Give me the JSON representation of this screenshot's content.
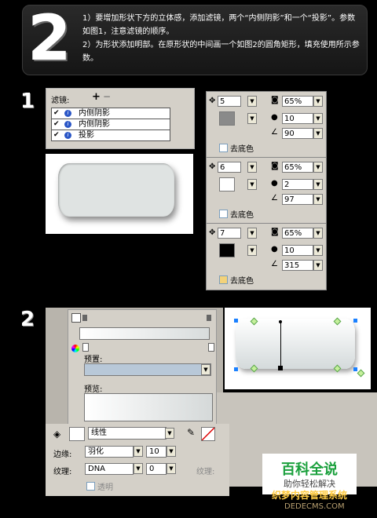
{
  "header": {
    "big_number": "2",
    "line1": "1）要增加形状下方的立体感，添加滤镜，两个“内侧阴影”和一个“投影”。参数如图1，注意滤镜的顺序。",
    "line2": "2）为形状添加明部。在原形状的中间画一个如图2的圆角矩形，填充使用所示参数。"
  },
  "steps": {
    "one": "1",
    "two": "2"
  },
  "filters": {
    "title": "滤镜:",
    "add": "+",
    "remove": "−",
    "items": [
      {
        "label": "内侧阴影",
        "checked": "✔"
      },
      {
        "label": "内侧阴影",
        "checked": "✔"
      },
      {
        "label": "投影",
        "checked": "✔"
      }
    ]
  },
  "params": [
    {
      "distance": "5",
      "opacity": "65%",
      "softness": "10",
      "angle": "90",
      "color": "#8a8a8a",
      "knockout": "去底色"
    },
    {
      "distance": "6",
      "opacity": "65%",
      "softness": "2",
      "angle": "97",
      "color": "#ffffff",
      "knockout": "去底色"
    },
    {
      "distance": "7",
      "opacity": "65%",
      "softness": "10",
      "angle": "315",
      "color": "#000000",
      "knockout": "去底色"
    }
  ],
  "gradient": {
    "preset_label": "预置:",
    "preview_label": "预览:"
  },
  "fill": {
    "type": "线性",
    "edge_label": "边缘:",
    "edge_value": "羽化",
    "edge_amount": "10",
    "texture_label": "纹理:",
    "texture_value": "DNA",
    "texture_amount": "0",
    "transparent": "透明",
    "texture_right": "纹理:"
  },
  "watermark": {
    "title": "百科全说",
    "subtitle": "助你轻松解决",
    "site1": "织梦内容管理系统",
    "site2": "DEDECMS.COM"
  }
}
